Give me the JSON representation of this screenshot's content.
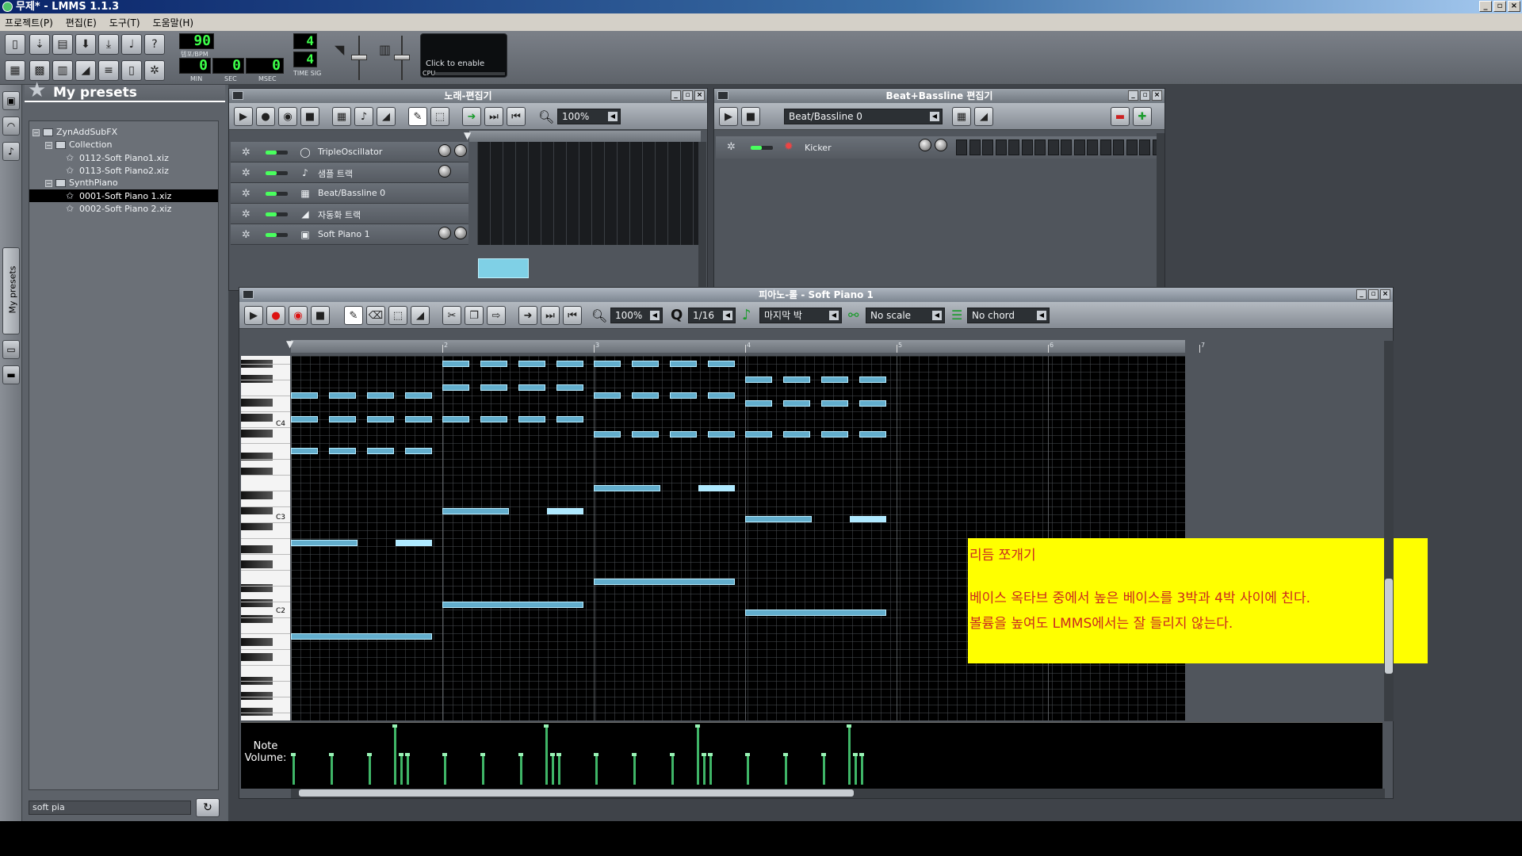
{
  "window": {
    "title": "무제* - LMMS 1.1.3"
  },
  "menu": [
    "프로젝트(P)",
    "편집(E)",
    "도구(T)",
    "도움말(H)"
  ],
  "toolbar": {
    "tempo": "90",
    "tempo_label": "템포/BPM",
    "time_min": "0",
    "time_sec": "0",
    "time_msec": "0",
    "time_min_label": "MIN",
    "time_sec_label": "SEC",
    "time_msec_label": "MSEC",
    "timesig_num": "4",
    "timesig_den": "4",
    "timesig_label": "TIME SIG",
    "cpu_text": "Click to enable",
    "cpu_label": "CPU"
  },
  "sidebar": {
    "mypresets_tab": "My presets"
  },
  "browser": {
    "title": "My presets",
    "tree": [
      {
        "label": "ZynAddSubFX",
        "level": 0,
        "kind": "folder"
      },
      {
        "label": "Collection",
        "level": 1,
        "kind": "folder"
      },
      {
        "label": "0112-Soft Piano1.xiz",
        "level": 2,
        "kind": "file"
      },
      {
        "label": "0113-Soft Piano2.xiz",
        "level": 2,
        "kind": "file"
      },
      {
        "label": "SynthPiano",
        "level": 1,
        "kind": "folder"
      },
      {
        "label": "0001-Soft Piano 1.xiz",
        "level": 2,
        "kind": "file",
        "selected": true
      },
      {
        "label": "0002-Soft Piano 2.xiz",
        "level": 2,
        "kind": "file"
      }
    ],
    "search": "soft pia"
  },
  "song_editor": {
    "title": "노래-편집기",
    "zoom": "100%",
    "tracks": [
      {
        "name": "TripleOscillator",
        "icon": "triple-oscillator-icon",
        "glyph": "◯"
      },
      {
        "name": "샘플 트랙",
        "icon": "sample-track-icon",
        "glyph": "♪"
      },
      {
        "name": "Beat/Bassline 0",
        "icon": "beat-bassline-icon",
        "glyph": "▦"
      },
      {
        "name": "자동화 트랙",
        "icon": "automation-icon",
        "glyph": "◢"
      },
      {
        "name": "Soft Piano 1",
        "icon": "zynaddsubfx-icon",
        "glyph": "▣"
      }
    ]
  },
  "beat_bassline": {
    "title": "Beat+Bassline 편집기",
    "selector": "Beat/Bassline 0",
    "track": {
      "name": "Kicker",
      "icon": "kicker-icon",
      "glyph": "✹"
    }
  },
  "piano_roll": {
    "title": "피아노-롤 - Soft Piano 1",
    "zoom": "100%",
    "quantize_label": "Q",
    "quantize": "1/16",
    "note_length": "마지막 박",
    "scale": "No scale",
    "chord": "No chord",
    "key_labels": [
      "C4",
      "C3",
      "C2"
    ],
    "bar_numbers": [
      "2",
      "3",
      "4",
      "5",
      "6",
      "7"
    ],
    "note_volume_label_1": "Note",
    "note_volume_label_2": "Volume:",
    "comment": {
      "line1": "리듬 쪼개기",
      "line2": "베이스 옥타브 중에서 높은 베이스를 3박과 4박 사이에 친다.",
      "line3": "볼륨을 높여도 LMMS에서는 잘 들리지 않는다."
    }
  },
  "colors": {
    "lcd": "#3dff4a",
    "note": "#63aecd",
    "comment_bg": "#ffff00",
    "comment_text": "#cc2a1f",
    "volume": "#3fb567"
  }
}
